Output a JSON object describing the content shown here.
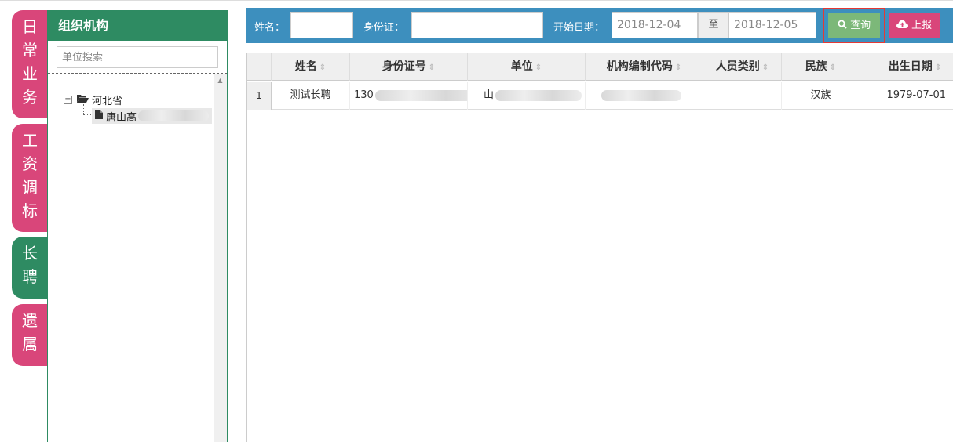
{
  "side_tabs": [
    {
      "label": "日常业务",
      "chars": [
        "日",
        "常",
        "业",
        "务"
      ],
      "color": "#d9467a"
    },
    {
      "label": "工资调标",
      "chars": [
        "工",
        "资",
        "调",
        "标"
      ],
      "color": "#d9467a"
    },
    {
      "label": "长聘",
      "chars": [
        "长",
        "聘"
      ],
      "color": "#2e8b62"
    },
    {
      "label": "遗属",
      "chars": [
        "遗",
        "属"
      ],
      "color": "#d9467a"
    }
  ],
  "org_panel": {
    "title": "组织机构",
    "search_placeholder": "单位搜索",
    "tree": {
      "root_label": "河北省",
      "root_toggle": "−",
      "child_label": "唐山高"
    }
  },
  "toolbar": {
    "name_label": "姓名：",
    "name_value": "",
    "id_label": "身份证：",
    "id_value": "",
    "start_date_label": "开始日期：",
    "start_date": "2018-12-04",
    "to_label": "至",
    "end_date": "2018-12-05",
    "query_label": "查询",
    "report_label": "上报"
  },
  "grid": {
    "columns": [
      "姓名",
      "身份证号",
      "单位",
      "机构编制代码",
      "人员类别",
      "民族",
      "出生日期"
    ],
    "rows": [
      {
        "num": "1",
        "name": "测试长聘",
        "id": "130",
        "unit": "山",
        "org_code": "",
        "category": "",
        "ethnicity": "汉族",
        "birth": "1979-07-01"
      }
    ]
  },
  "colors": {
    "green": "#2e8b62",
    "pink": "#d9467a",
    "toolbar_blue": "#3d8fbe",
    "query_green": "#7cb879",
    "highlight_red": "#e53935"
  }
}
